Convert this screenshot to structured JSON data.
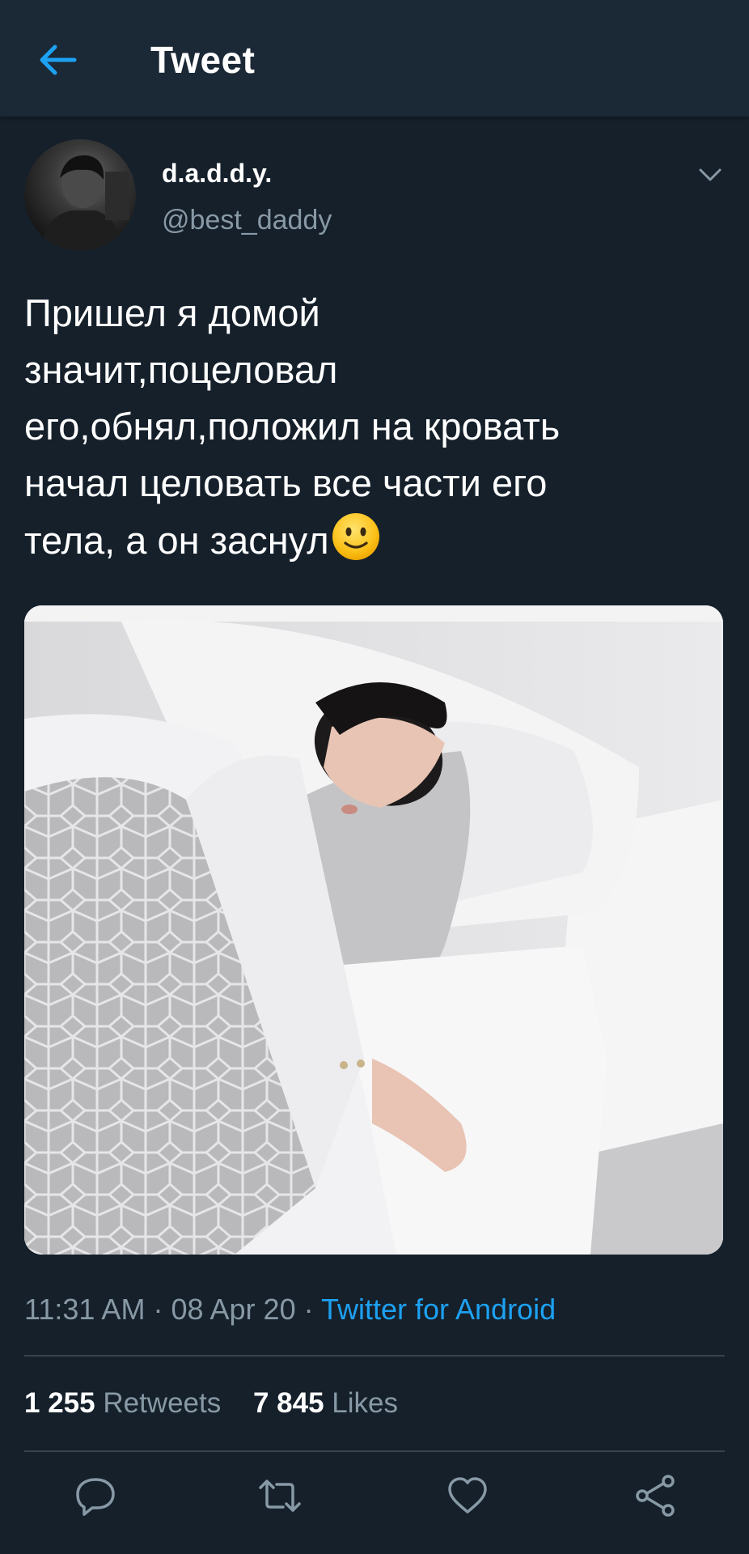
{
  "header": {
    "title": "Tweet",
    "back_icon": "arrow-left-icon"
  },
  "author": {
    "display_name": "d.a.d.d.y.",
    "handle": "@best_daddy"
  },
  "tweet": {
    "text": "Пришел я домой\nзначит,поцеловал\nего,обнял,положил на кровать\nначал целовать все части его\nтела, а он заснул",
    "emoji": "slightly-smiling-face"
  },
  "media": {
    "description_icon": "photo"
  },
  "meta": {
    "time": "11:31 AM",
    "date": "08 Apr 20",
    "separator": "·",
    "source": "Twitter for Android"
  },
  "stats": {
    "retweets_count": "1 255",
    "retweets_label": "Retweets",
    "likes_count": "7 845",
    "likes_label": "Likes"
  },
  "actions": [
    "reply-icon",
    "retweet-icon",
    "like-icon",
    "share-icon"
  ],
  "colors": {
    "background": "#15202b",
    "header": "#1b2836",
    "accent": "#1da1f2",
    "muted": "#8899a6",
    "divider": "#38444d"
  }
}
